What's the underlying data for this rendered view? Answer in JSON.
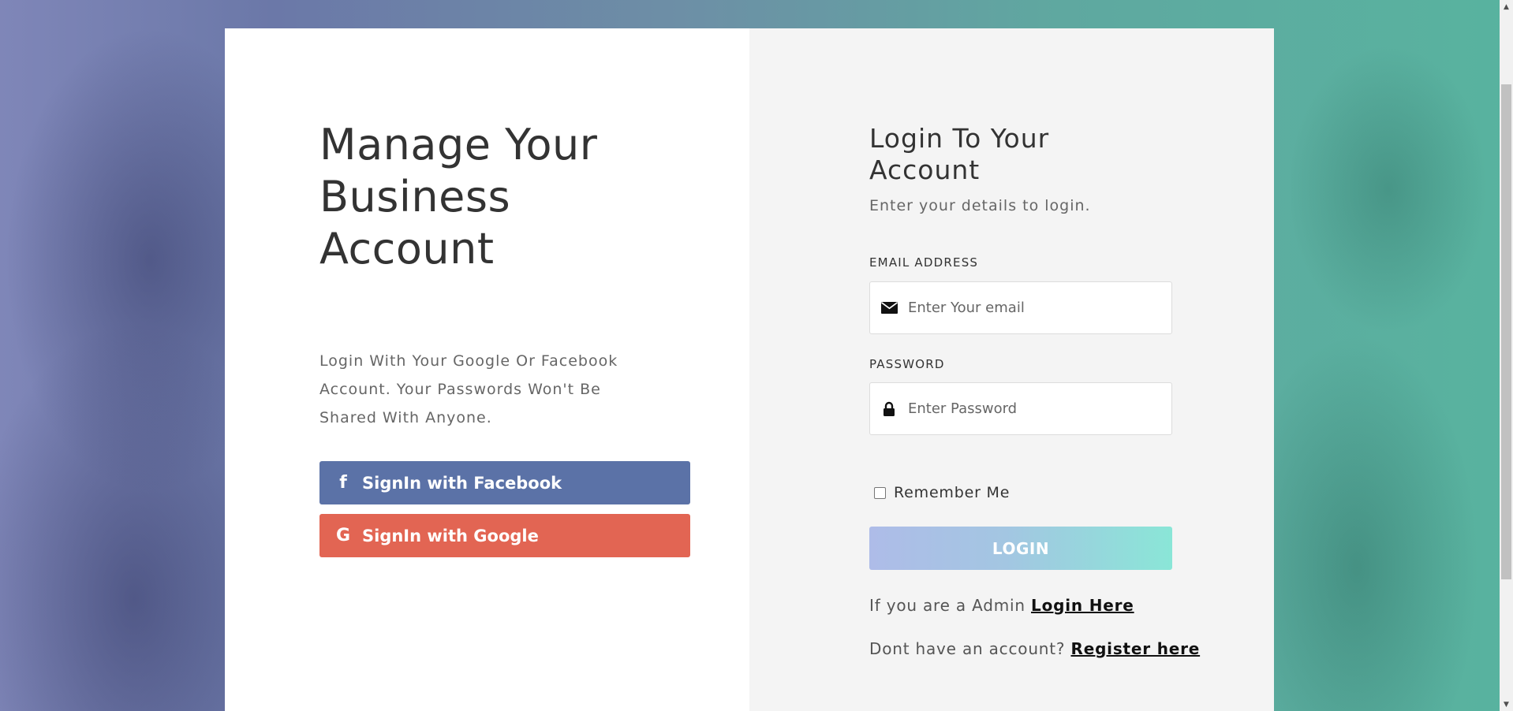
{
  "left_panel": {
    "headline": "Manage Your Business Account",
    "lead": "Login With Your Google Or Facebook Account. Your Passwords Won't Be Shared With Anyone.",
    "facebook_button": {
      "icon": "f",
      "label": "SignIn with Facebook"
    },
    "google_button": {
      "icon": "G",
      "label": "SignIn with Google"
    }
  },
  "login_form": {
    "title": "Login To Your Account",
    "subtitle": "Enter your details to login.",
    "email": {
      "label": "EMAIL ADDRESS",
      "placeholder": "Enter Your email",
      "icon": "envelope-icon"
    },
    "password": {
      "label": "PASSWORD",
      "placeholder": "Enter Password",
      "icon": "lock-icon"
    },
    "remember_label": "Remember Me",
    "remember_checked": false,
    "login_button": "LOGIN",
    "admin_prompt": "If you are a Admin",
    "admin_link": "Login Here",
    "register_prompt": "Dont have an account?",
    "register_link": "Register here"
  },
  "colors": {
    "facebook": "#5b72a7",
    "google": "#e26553",
    "login_gradient_start": "#aebce8",
    "login_gradient_end": "#8ae6d7"
  }
}
